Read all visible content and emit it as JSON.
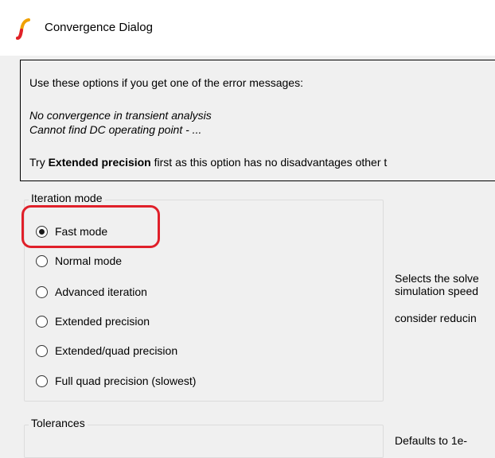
{
  "window": {
    "title": "Convergence Dialog",
    "icon": "ltspice-logo-icon"
  },
  "info": {
    "intro": "Use these options if you get one of the error messages:",
    "error1": "No convergence in transient analysis",
    "error2": "Cannot find DC operating point - ...",
    "try_prefix": "Try ",
    "try_bold": "Extended precision",
    "try_suffix": " first as this option has no disadvantages other t"
  },
  "iteration_mode": {
    "title": "Iteration mode",
    "options": [
      {
        "label": "Fast mode",
        "checked": true
      },
      {
        "label": "Normal mode",
        "checked": false
      },
      {
        "label": "Advanced iteration",
        "checked": false
      },
      {
        "label": "Extended precision",
        "checked": false
      },
      {
        "label": "Extended/quad precision",
        "checked": false
      },
      {
        "label": "Full quad precision (slowest)",
        "checked": false
      }
    ],
    "description_line1": "Selects the solve",
    "description_line2": "simulation speed",
    "description_line3": "consider reducin"
  },
  "tolerances": {
    "title": "Tolerances",
    "description": "Defaults to 1e-"
  },
  "colors": {
    "highlight": "#e0202a",
    "background": "#f0f0f0"
  }
}
